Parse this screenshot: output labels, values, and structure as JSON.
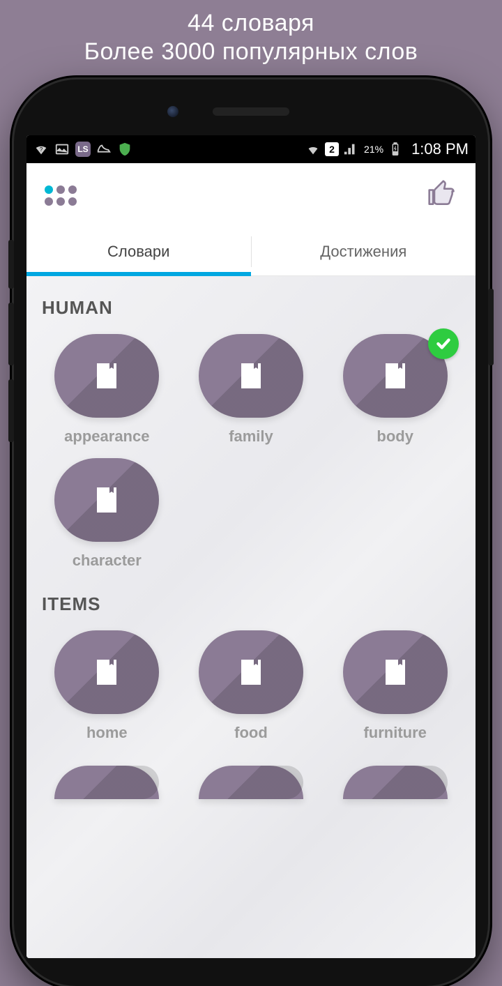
{
  "promo": {
    "line1": "44 словаря",
    "line2": "Более 3000 популярных слов"
  },
  "statusbar": {
    "sim": "2",
    "battery": "21%",
    "time": "1:08 PM"
  },
  "tabs": {
    "dictionaries": "Словари",
    "achievements": "Достижения"
  },
  "sections": [
    {
      "title": "HUMAN",
      "items": [
        {
          "label": "appearance",
          "completed": false
        },
        {
          "label": "family",
          "completed": false
        },
        {
          "label": "body",
          "completed": true
        },
        {
          "label": "character",
          "completed": false
        }
      ]
    },
    {
      "title": "ITEMS",
      "items": [
        {
          "label": "home",
          "completed": false
        },
        {
          "label": "food",
          "completed": false
        },
        {
          "label": "furniture",
          "completed": false
        }
      ]
    }
  ]
}
